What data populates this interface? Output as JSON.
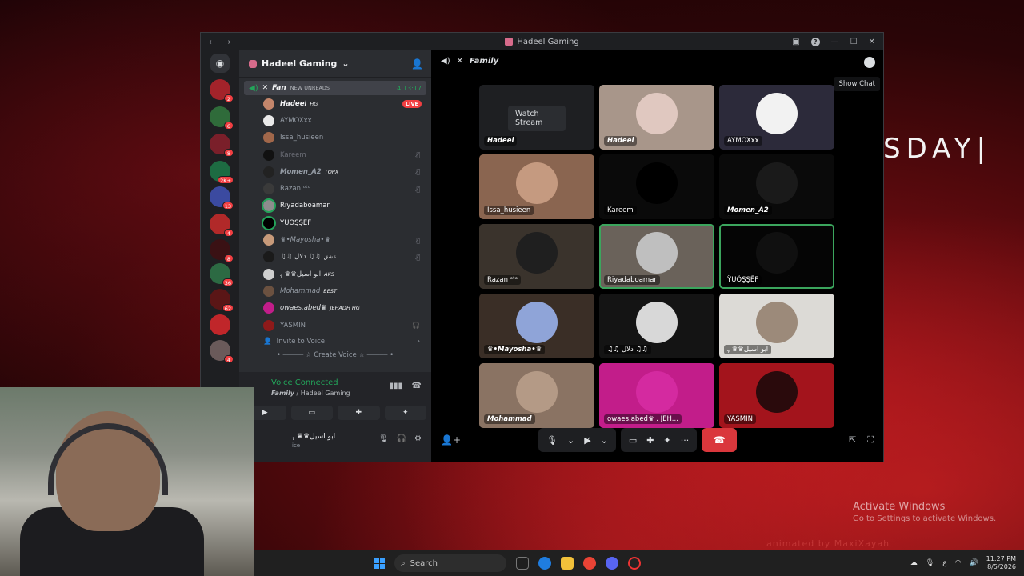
{
  "window": {
    "title": "Hadeel Gaming"
  },
  "desktop": {
    "banner": "SDAY|",
    "activate_title": "Activate Windows",
    "activate_sub": "Go to Settings to activate Windows.",
    "animated": "animated by MaxiXayah"
  },
  "rail": {
    "badges": [
      "2",
      "6",
      "8",
      "2K+",
      "13",
      "4",
      "8",
      "36",
      "62",
      "",
      "4"
    ]
  },
  "sidebar": {
    "server_name": "Hadeel Gaming",
    "channel": {
      "name": "Fan",
      "new_unreads": "NEW UNREADS",
      "timer": "4:13:17"
    },
    "members": [
      {
        "name": "Hadeel",
        "tag": "HG",
        "live": "LIVE"
      },
      {
        "name": "AYMOXxx"
      },
      {
        "name": "Issa_husieen"
      },
      {
        "name": "Kareem"
      },
      {
        "name": "Momen_A2",
        "tag": "TOPX"
      },
      {
        "name": "Razan ᵒᵗᵒ"
      },
      {
        "name": "Riyadaboamar"
      },
      {
        "name": "ŸUÖŞŞÊF"
      },
      {
        "name": "♛•Mayosha•♛"
      },
      {
        "name": "♫♫ دلال ♫♫",
        "tag": "عشق"
      },
      {
        "name": "ابو اسيل♛♛ ﮩ",
        "tag": "AKS"
      },
      {
        "name": "Mohammad",
        "tag": "BEST"
      },
      {
        "name": "owaes.abed♛",
        "tag": "JEHADH HG"
      },
      {
        "name": "YASMIN"
      }
    ],
    "invite": "Invite to Voice",
    "create_voice": "Create Voice",
    "voice": {
      "connected": "Voice Connected",
      "channel": "Family",
      "server": "Hadeel Gaming",
      "user": "ابو اسيل♛♛ ﮩ",
      "sub": "ice"
    }
  },
  "stage": {
    "channel": "Family",
    "tooltip": "Show Chat",
    "watch_stream": "Watch Stream",
    "tiles": [
      {
        "label": "Hadeel"
      },
      {
        "label": "Hadeel"
      },
      {
        "label": "AYMOXxx"
      },
      {
        "label": "Issa_husieen"
      },
      {
        "label": "Kareem"
      },
      {
        "label": "Momen_A2"
      },
      {
        "label": "Razan ᵒᵗᵒ"
      },
      {
        "label": "Riyadaboamar"
      },
      {
        "label": "ŸUÖŞŞÊF"
      },
      {
        "label": "♛•Mayosha•♛"
      },
      {
        "label": "♫♫ دلال ♫♫"
      },
      {
        "label": "ابو اسيل♛♛ ﮩ"
      },
      {
        "label": "Mohammad"
      },
      {
        "label": "owaes.abed♛ . JEH..."
      },
      {
        "label": "YASMIN"
      }
    ]
  },
  "taskbar": {
    "search": "Search",
    "time": "11:27 PM",
    "date": "8/5/2026",
    "lang": "ع"
  }
}
